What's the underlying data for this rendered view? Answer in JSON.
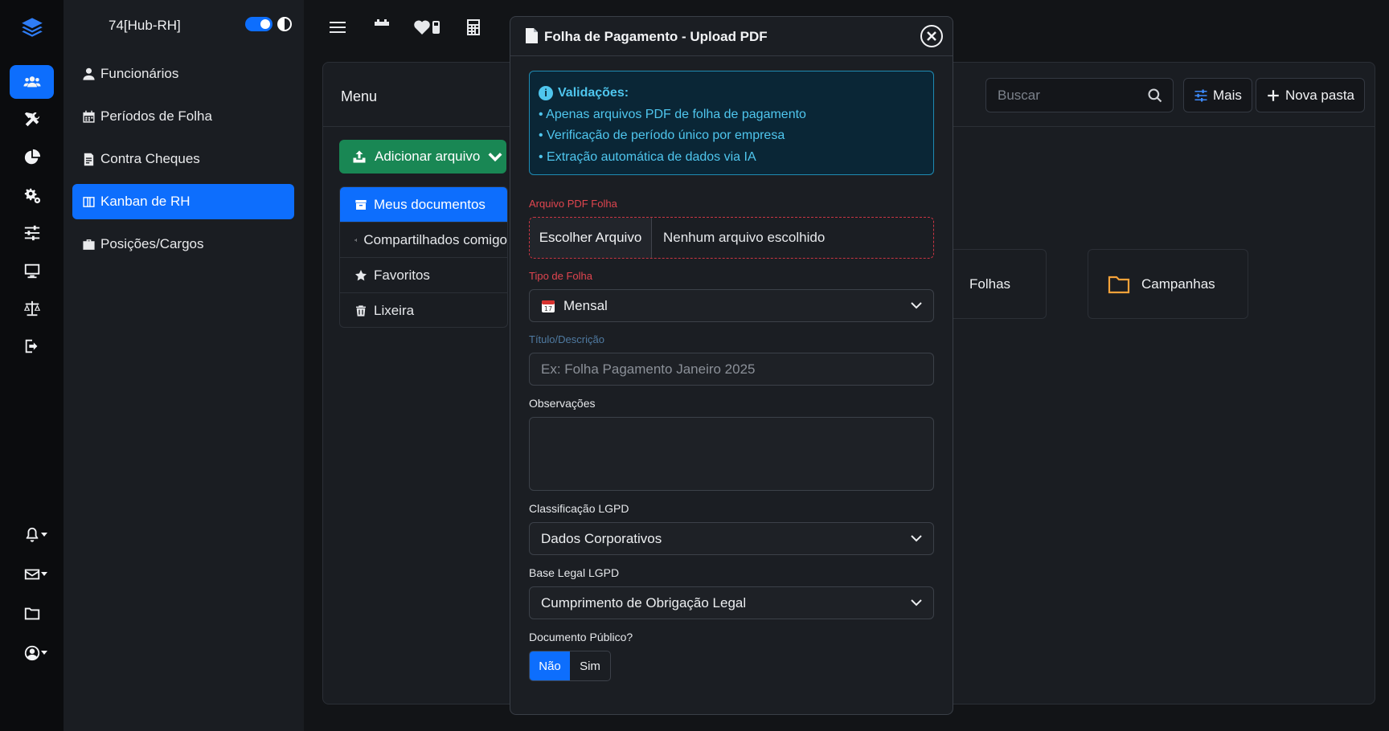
{
  "sidebar": {
    "brand": "74[Hub-RH]",
    "items": [
      {
        "label": "Funcionários"
      },
      {
        "label": "Períodos de Folha"
      },
      {
        "label": "Contra Cheques"
      },
      {
        "label": "Kanban de RH"
      },
      {
        "label": "Posições/Cargos"
      }
    ]
  },
  "main": {
    "title": "Menu",
    "search_placeholder": "Buscar",
    "more_label": "Mais",
    "new_folder_label": "Nova pasta",
    "add_file_label": "Adicionar arquivo",
    "menu": [
      {
        "label": "Meus documentos"
      },
      {
        "label": "Compartilhados comigo"
      },
      {
        "label": "Favoritos"
      },
      {
        "label": "Lixeira"
      }
    ],
    "folders": [
      {
        "label": "Folhas"
      },
      {
        "label": "Campanhas"
      }
    ]
  },
  "modal": {
    "title": "Folha de Pagamento - Upload PDF",
    "alert": {
      "heading": "Validações:",
      "lines": [
        "• Apenas arquivos PDF de folha de pagamento",
        "• Verificação de período único por empresa",
        "• Extração automática de dados via IA"
      ]
    },
    "file_label": "Arquivo PDF Folha",
    "file_button": "Escolher Arquivo",
    "file_status": "Nenhum arquivo escolhido",
    "type_label": "Tipo de Folha",
    "type_value": "Mensal",
    "title_label": "Título/Descrição",
    "title_placeholder": "Ex: Folha Pagamento Janeiro 2025",
    "notes_label": "Observações",
    "lgpd_class_label": "Classificação LGPD",
    "lgpd_class_value": "Dados Corporativos",
    "lgpd_base_label": "Base Legal LGPD",
    "lgpd_base_value": "Cumprimento de Obrigação Legal",
    "public_label": "Documento Público?",
    "public_no": "Não",
    "public_yes": "Sim"
  },
  "colors": {
    "primary": "#0d6efd",
    "success": "#198754",
    "danger": "#e0454f",
    "info": "#4fc6ee",
    "folder": "#f5a23a"
  }
}
